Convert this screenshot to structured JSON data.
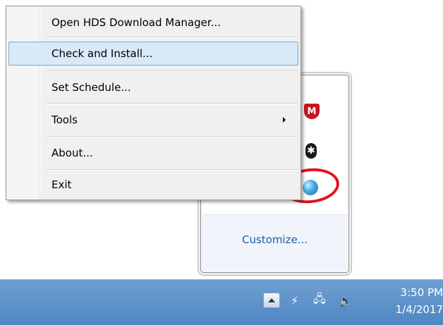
{
  "context_menu": {
    "items": [
      {
        "label": "Open HDS Download Manager..."
      },
      {
        "label": "Check and Install..."
      },
      {
        "label": "Set Schedule..."
      },
      {
        "label": "Tools"
      },
      {
        "label": "About..."
      },
      {
        "label": "Exit"
      }
    ],
    "highlighted_index": 1
  },
  "tray_overflow": {
    "icons": [
      "mcafee-shield-icon",
      "bluetooth-icon",
      "hds-globe-icon"
    ],
    "customize_label": "Customize..."
  },
  "taskbar": {
    "clock_time": "3:50 PM",
    "clock_date": "1/4/2017",
    "icons": [
      "show-hidden-icons-arrow",
      "power-icon",
      "network-icon",
      "volume-icon"
    ]
  },
  "colors": {
    "menu_highlight": "#d9e9f8",
    "highlight_circle": "#e3131b",
    "taskbar": "#5b8fc8",
    "link": "#1e5aa8"
  }
}
